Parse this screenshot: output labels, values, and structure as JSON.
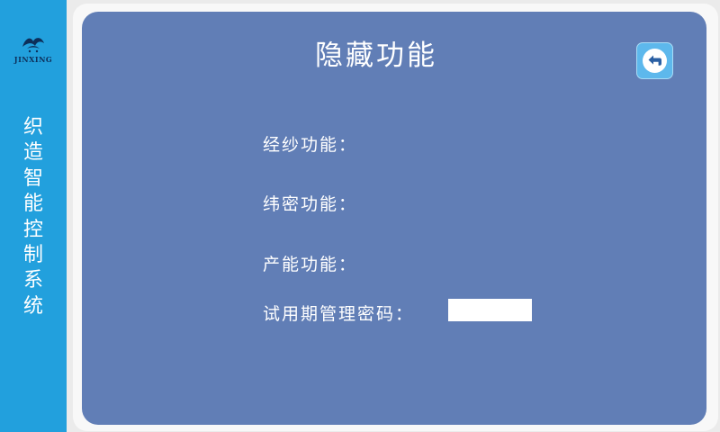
{
  "sidebar": {
    "logo_text": "JINXING",
    "title_chars": [
      "织",
      "造",
      "智",
      "能",
      "控",
      "制",
      "系",
      "统"
    ]
  },
  "page": {
    "title": "隐藏功能"
  },
  "settings": {
    "warp_label": "经纱功能：",
    "weft_label": "纬密功能：",
    "output_label": "产能功能：",
    "trial_password_label": "试用期管理密码："
  },
  "trial_password": {
    "value": ""
  },
  "colors": {
    "sidebar": "#22a0dd",
    "panel": "#617eb6",
    "back_button": "#5db8ec"
  },
  "icons": {
    "back": "back-arrow-icon",
    "logo": "jinxing-logo"
  }
}
